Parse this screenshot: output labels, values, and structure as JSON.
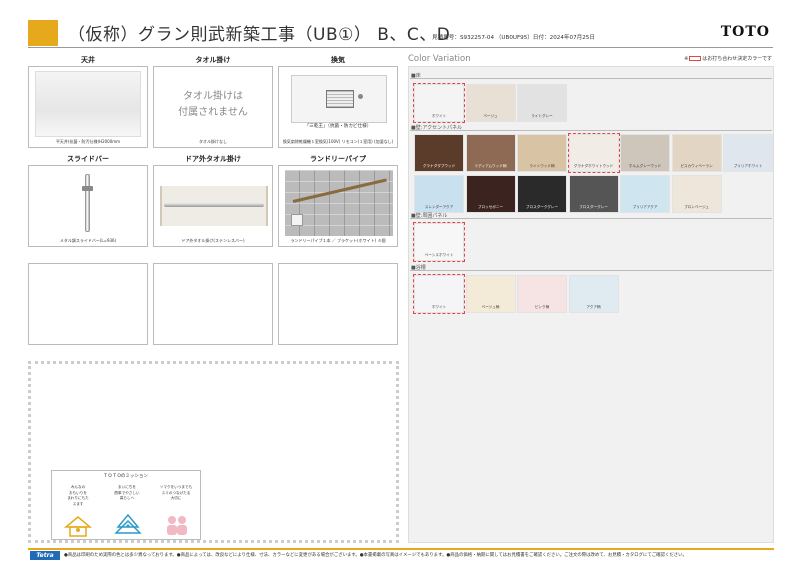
{
  "header": {
    "title": "（仮称）グラン則武新築工事（UB①） B、C、D",
    "quote_line": "見積番号：S932257-04 （UB0UF95）日付：2024年07月25日",
    "brand": "TOTO",
    "accent_color": "#e6a91c"
  },
  "products": [
    {
      "title": "天井",
      "caption": "平天井(抗菌・防汚仕様)H2000mm"
    },
    {
      "title": "タオル掛け",
      "body_line1": "タオル掛けは",
      "body_line2": "付属されません",
      "caption": "タオル掛けなし"
    },
    {
      "title": "換気",
      "inner_label": "「三乾王」（抗菌・防カビ仕様）",
      "caption": "換気扇除乾燥機１室換気(100V) リモコン(１室用)  (加湿なし)"
    },
    {
      "title": "スライドバー",
      "caption": "メタル調スライドバー(L=936)"
    },
    {
      "title": "ドア外タオル掛け",
      "caption": "ドア外タオル掛け(ステンレスバー)"
    },
    {
      "title": "ランドリーパイプ",
      "caption": "ランドリーパイプ１本 ／ ブラケット(ホワイト) ４個"
    }
  ],
  "mission": {
    "title": "T O T Oのミッション",
    "col1": "みんなの\nおもいりを\nまわりにもた\nスます",
    "col2": "まいにちを\n簡単でやさしい\n暮らしへ",
    "col3": "ソマクをいつまでも\nスミのつなげたる\n大切に"
  },
  "color_panel": {
    "title": "Color Variation",
    "note_prefix": "※",
    "note_suffix": "はお打ち合わせ決定カラーです",
    "sections": [
      {
        "label": "■床",
        "swatches": [
          {
            "name": "ホワイト",
            "color": "#f4f4f4",
            "selected": true,
            "light": false
          },
          {
            "name": "ベージュ",
            "color": "#e8e0d4",
            "selected": false,
            "light": false
          },
          {
            "name": "ライトグレー",
            "color": "#e2e2e2",
            "selected": false,
            "light": false
          }
        ]
      },
      {
        "label": "■壁:アクセントパネル",
        "swatches": [
          {
            "name": "グラナダダブウッド",
            "color": "#5b3b2a",
            "selected": false,
            "light": true
          },
          {
            "name": "ミディアムウッド柄",
            "color": "#8e6a54",
            "selected": false,
            "light": true
          },
          {
            "name": "ライトウッド柄",
            "color": "#d9c3a5",
            "selected": false,
            "light": false
          },
          {
            "name": "グラナダホワイトウッド",
            "color": "#f1ede6",
            "selected": true,
            "light": false
          },
          {
            "name": "ホルムグレーウッド",
            "color": "#cfc6bb",
            "selected": false,
            "light": false
          },
          {
            "name": "ピスカウィベーラン",
            "color": "#e2d5c4",
            "selected": false,
            "light": false
          },
          {
            "name": "ブリリアホワイト",
            "color": "#dfe6ee",
            "selected": false,
            "light": false
          },
          {
            "name": "スレンダーアクア",
            "color": "#c9e0ef",
            "selected": false,
            "light": false
          },
          {
            "name": "ブロッセボニー",
            "color": "#3b2420",
            "selected": false,
            "light": true
          },
          {
            "name": "ブロスダークグレー",
            "color": "#2a2a2a",
            "selected": false,
            "light": true
          },
          {
            "name": "ブロスダーグレー",
            "color": "#555555",
            "selected": false,
            "light": true
          },
          {
            "name": "ブリリアアクア",
            "color": "#cfe6f0",
            "selected": false,
            "light": false
          },
          {
            "name": "ブロンベージュ",
            "color": "#eee6da",
            "selected": false,
            "light": false
          }
        ]
      },
      {
        "label": "■壁:周囲パネル",
        "swatches": [
          {
            "name": "ベーシスホワイト",
            "color": "#f7f7f7",
            "selected": true,
            "light": false
          }
        ]
      },
      {
        "label": "■浴槽",
        "swatches": [
          {
            "name": "ホワイト",
            "color": "#f5f5f7",
            "selected": true,
            "light": false
          },
          {
            "name": "ベージュ柄",
            "color": "#f3ead8",
            "selected": false,
            "light": false
          },
          {
            "name": "ピンク柄",
            "color": "#f6e4e4",
            "selected": false,
            "light": false
          },
          {
            "name": "アクア柄",
            "color": "#dfeaf1",
            "selected": false,
            "light": false
          }
        ]
      }
    ]
  },
  "footer": {
    "logo": "Tetra",
    "text": "●商品は印刷のため実際の色とは多少異なっております。●商品によっては、改良などにより仕様、寸法、カラーなどに変更がある場合がございます。●本書掲載の写真はイメージでもあります。●商品の価格・納期に関してはお見積書をご確認ください。ご注文の際は改めて、お見積・カタログにてご確認ください。"
  }
}
